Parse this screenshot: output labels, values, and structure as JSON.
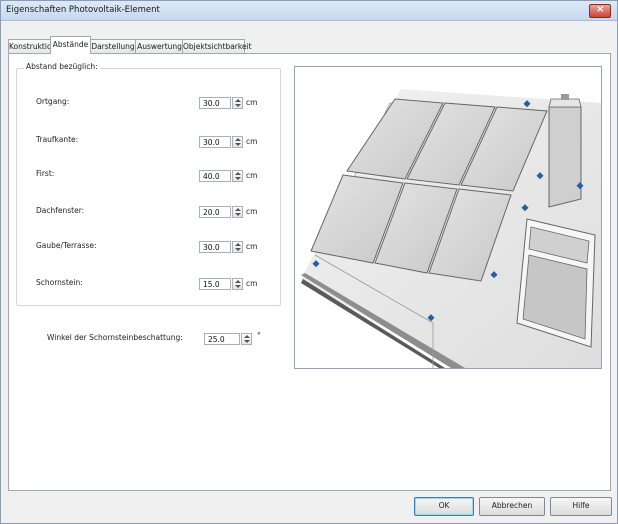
{
  "window": {
    "title": "Eigenschaften Photovoltaik-Element"
  },
  "tabs": [
    {
      "label": "Konstruktion"
    },
    {
      "label": "Abstände"
    },
    {
      "label": "Darstellung"
    },
    {
      "label": "Auswertung"
    },
    {
      "label": "Objektsichtbarkeit"
    }
  ],
  "group": {
    "title": "Abstand bezüglich:"
  },
  "rows": [
    {
      "label": "Ortgang:",
      "value": "30.0",
      "unit": "cm"
    },
    {
      "label": "Traufkante:",
      "value": "30.0",
      "unit": "cm"
    },
    {
      "label": "First:",
      "value": "40.0",
      "unit": "cm"
    },
    {
      "label": "Dachfenster:",
      "value": "20.0",
      "unit": "cm"
    },
    {
      "label": "Gaube/Terrasse:",
      "value": "30.0",
      "unit": "cm"
    },
    {
      "label": "Schornstein:",
      "value": "15.0",
      "unit": "cm"
    }
  ],
  "angle": {
    "label": "Winkel der Schornsteinbeschattung:",
    "value": "25.0",
    "unit": "°"
  },
  "buttons": {
    "ok": "OK",
    "cancel": "Abbrechen",
    "help": "Hilfe"
  }
}
